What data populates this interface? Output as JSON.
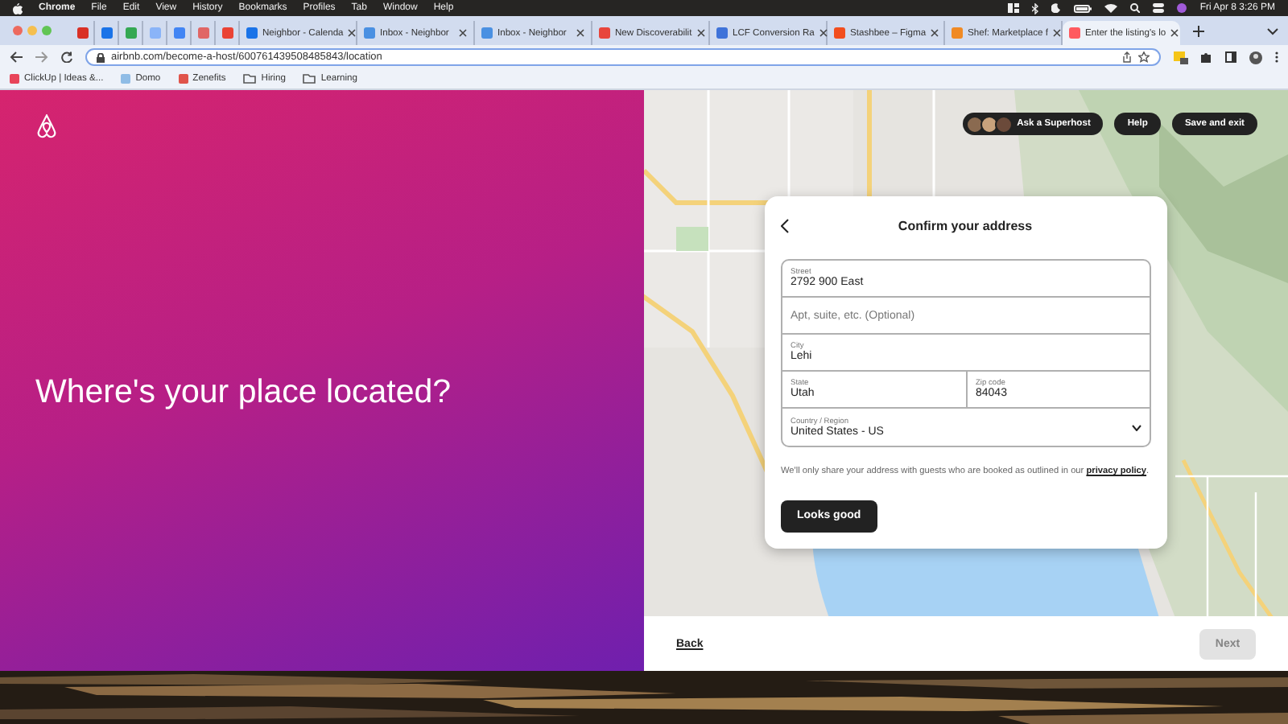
{
  "menu_bar": {
    "app": "Chrome",
    "menus": [
      "File",
      "Edit",
      "View",
      "History",
      "Bookmarks",
      "Profiles",
      "Tab",
      "Window",
      "Help"
    ],
    "clock": "Fri Apr 8 3:26 PM"
  },
  "pinned_tabs": [
    {
      "color": "#d93025"
    },
    {
      "color": "#1a73e8"
    },
    {
      "color": "#34a853"
    },
    {
      "color": "#8ab4f8"
    },
    {
      "color": "#4285f4"
    },
    {
      "color": "#e06666"
    },
    {
      "color": "#ea4335"
    }
  ],
  "tabs": [
    {
      "title": "Neighbor - Calenda",
      "color": "#1a73e8",
      "selected": false
    },
    {
      "title": "Inbox - Neighbor",
      "color": "#4a90e2",
      "selected": false
    },
    {
      "title": "Inbox - Neighbor",
      "color": "#4a90e2",
      "selected": false
    },
    {
      "title": "New Discoverabilit",
      "color": "#e8453c",
      "selected": false
    },
    {
      "title": "LCF Conversion Ra",
      "color": "#3f73d9",
      "selected": false
    },
    {
      "title": "Stashbee – Figma",
      "color": "#f24e1e",
      "selected": false
    },
    {
      "title": "Shef: Marketplace f",
      "color": "#f08a24",
      "selected": false
    },
    {
      "title": "Enter the listing's lo",
      "color": "#ff5a5f",
      "selected": true
    }
  ],
  "toolbar": {
    "url": "airbnb.com/become-a-host/600761439508485843/location"
  },
  "bookmarks": [
    {
      "label": "ClickUp | Ideas &...",
      "kind": "site",
      "color": "#e8445a"
    },
    {
      "label": "Domo",
      "kind": "site",
      "color": "#8fbce6"
    },
    {
      "label": "Zenefits",
      "kind": "site",
      "color": "#e0544b"
    },
    {
      "label": "Hiring",
      "kind": "folder"
    },
    {
      "label": "Learning",
      "kind": "folder"
    }
  ],
  "host_page": {
    "heading": "Where's your place located?",
    "actions": [
      {
        "label": "Ask a Superhost",
        "kind": "superhost"
      },
      {
        "label": "Help",
        "kind": "plain"
      },
      {
        "label": "Save and exit",
        "kind": "plain"
      }
    ],
    "address_card": {
      "title": "Confirm your address",
      "fields": [
        {
          "kind": "text",
          "label": "Street",
          "value": "2792 900 East"
        },
        {
          "kind": "text",
          "placeholder": "Apt, suite, etc. (Optional)"
        },
        {
          "kind": "text",
          "label": "City",
          "value": "Lehi"
        },
        {
          "kind": "half",
          "label": "State",
          "value": "Utah"
        },
        {
          "kind": "half",
          "label": "Zip code",
          "value": "84043"
        },
        {
          "kind": "select",
          "label": "Country / Region",
          "value": "United States - US"
        }
      ],
      "note": "We'll only share your address with guests who are booked as outlined in our",
      "note_link": "privacy policy",
      "note_end": ".",
      "submit": "Looks good"
    },
    "footer": {
      "back": "Back",
      "next": {
        "label": "Next",
        "disabled": true
      }
    }
  }
}
